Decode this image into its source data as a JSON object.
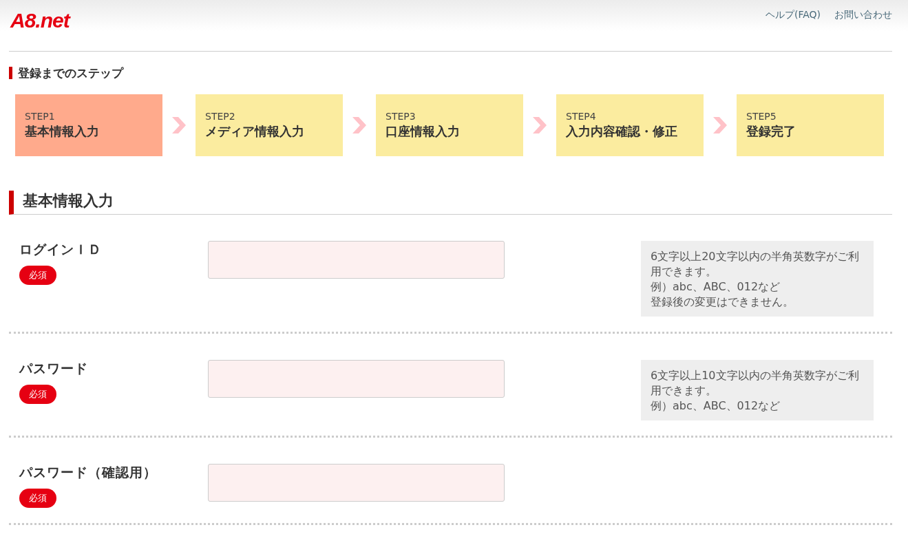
{
  "header": {
    "logo": "A8.net",
    "links": [
      "ヘルプ(FAQ)",
      "お問い合わせ"
    ]
  },
  "steps_title": "登録までのステップ",
  "steps": [
    {
      "step": "STEP1",
      "label": "基本情報入力",
      "selected": true
    },
    {
      "step": "STEP2",
      "label": "メディア情報入力",
      "selected": false
    },
    {
      "step": "STEP3",
      "label": "口座情報入力",
      "selected": false
    },
    {
      "step": "STEP4",
      "label": "入力内容確認・修正",
      "selected": false
    },
    {
      "step": "STEP5",
      "label": "登録完了",
      "selected": false
    }
  ],
  "section_title": "基本情報入力",
  "fields": [
    {
      "label": "ログインＩＤ",
      "badge": "必須",
      "note": [
        "6文字以上20文字以内の半角英数字がご利用できます。",
        "例）abc、ABC、012など",
        "登録後の変更はできません。"
      ]
    },
    {
      "label": "パスワード",
      "badge": "必須",
      "note": [
        "6文字以上10文字以内の半角英数字がご利用できます。",
        "例）abc、ABC、012など"
      ]
    },
    {
      "label": "パスワード（確認用）",
      "badge": "必須"
    }
  ]
}
